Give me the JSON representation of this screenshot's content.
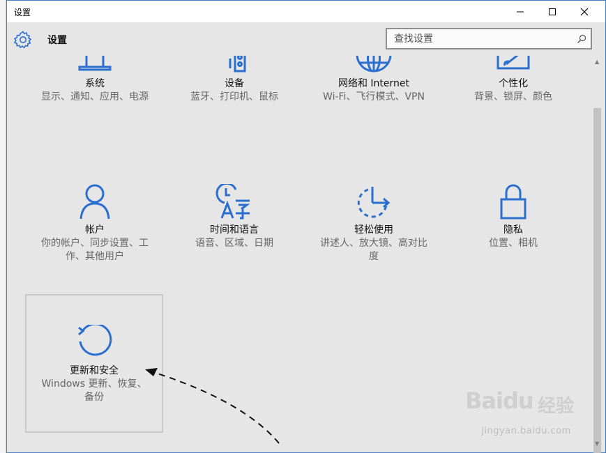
{
  "window": {
    "title": "设置"
  },
  "header": {
    "app_title": "设置",
    "search_placeholder": "查找设置"
  },
  "tiles": [
    {
      "name": "系统",
      "desc": "显示、通知、应用、电源",
      "icon": "laptop-icon"
    },
    {
      "name": "设备",
      "desc": "蓝牙、打印机、鼠标",
      "icon": "devices-icon"
    },
    {
      "name": "网络和 Internet",
      "desc": "Wi-Fi、飞行模式、VPN",
      "icon": "globe-icon"
    },
    {
      "name": "个性化",
      "desc": "背景、锁屏、颜色",
      "icon": "personalize-icon"
    },
    {
      "name": "帐户",
      "desc": "你的帐户、同步设置、工作、其他用户",
      "icon": "person-icon"
    },
    {
      "name": "时间和语言",
      "desc": "语音、区域、日期",
      "icon": "time-language-icon"
    },
    {
      "name": "轻松使用",
      "desc": "讲述人、放大镜、高对比度",
      "icon": "ease-of-access-icon"
    },
    {
      "name": "隐私",
      "desc": "位置、相机",
      "icon": "lock-icon"
    },
    {
      "name": "更新和安全",
      "desc": "Windows 更新、恢复、备份",
      "icon": "update-icon"
    }
  ],
  "watermark": {
    "brand": "Bai",
    "brand2": "du",
    "brand_cn": "经验",
    "url": "jingyan.baidu.com"
  },
  "colors": {
    "accent": "#2a6fd0",
    "window_bg": "#e6e6e6"
  }
}
